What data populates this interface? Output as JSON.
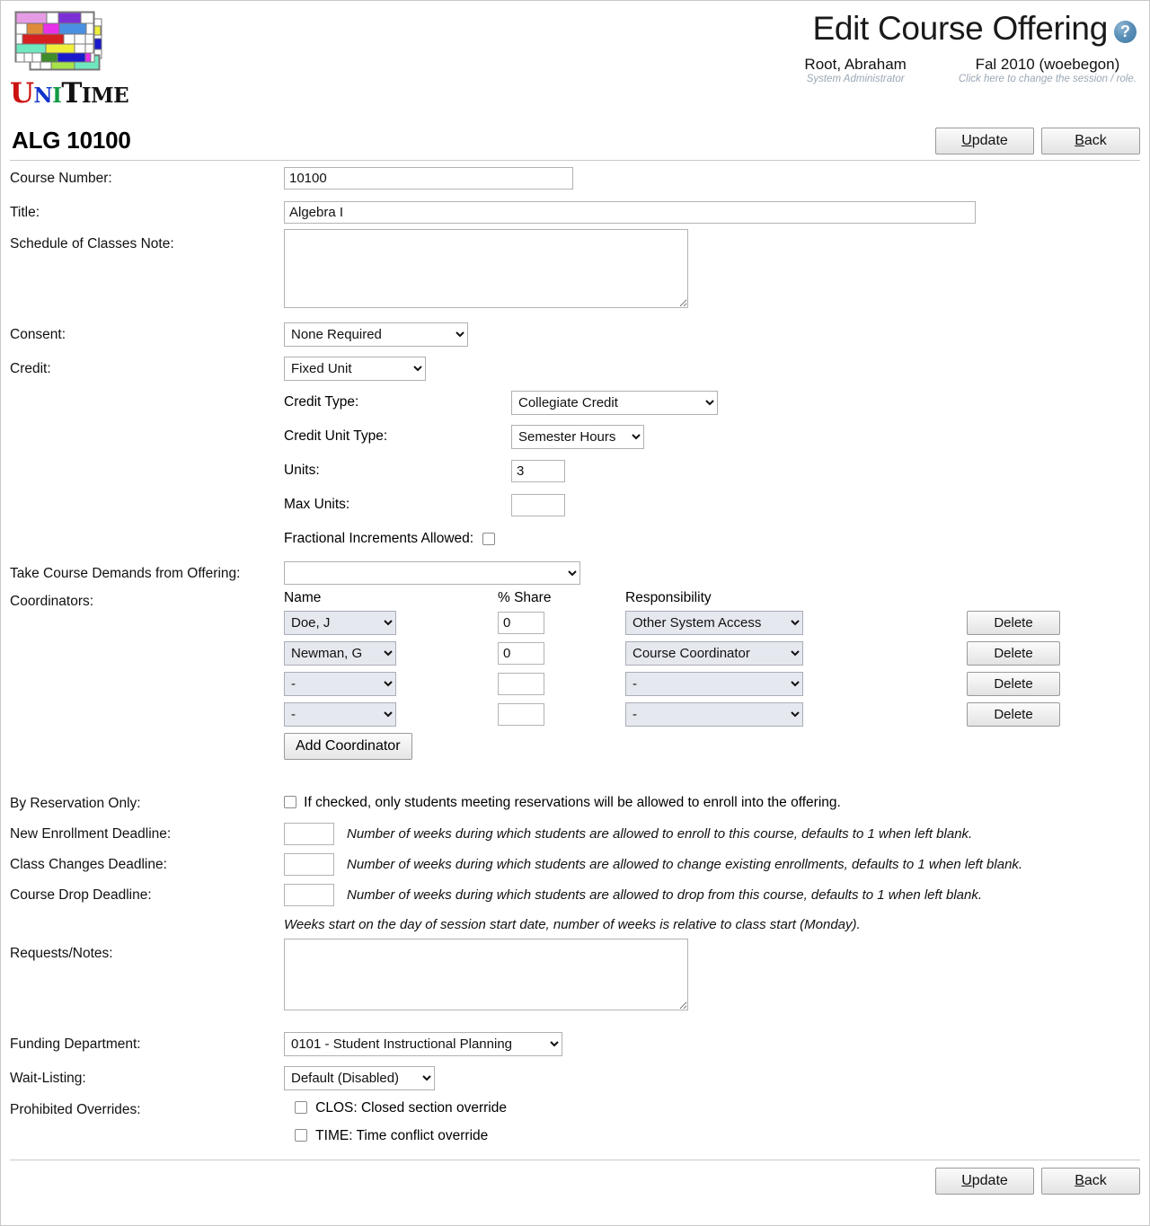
{
  "header": {
    "logo_alt": "UniTime logo",
    "wordmark": {
      "u": "U",
      "n": "N",
      "i": "I",
      "t": "T",
      "ime": "IME"
    },
    "app_title": "Edit Course Offering",
    "help_icon": "help-icon",
    "user_name": "Root, Abraham",
    "user_role": "System Administrator",
    "session": "Fal 2010 (woebegon)",
    "session_hint": "Click here to change the session / role."
  },
  "course": {
    "code": "ALG 10100"
  },
  "toolbar": {
    "update_accesskey": "U",
    "update_rest": "pdate",
    "back_accesskey": "B",
    "back_rest": "ack"
  },
  "form": {
    "course_number_label": "Course Number:",
    "course_number_value": "10100",
    "title_label": "Title:",
    "title_value": "Algebra I",
    "schedule_note_label": "Schedule of Classes Note:",
    "schedule_note_value": "",
    "consent_label": "Consent:",
    "consent_value": "None Required",
    "credit_label": "Credit:",
    "credit_value": "Fixed Unit",
    "credit_type_label": "Credit Type:",
    "credit_type_value": "Collegiate Credit",
    "credit_unit_type_label": "Credit Unit Type:",
    "credit_unit_type_value": "Semester Hours",
    "units_label": "Units:",
    "units_value": "3",
    "max_units_label": "Max Units:",
    "max_units_value": "",
    "fractional_label": "Fractional Increments Allowed:",
    "demands_label": "Take Course Demands from Offering:",
    "demands_value": "",
    "coordinators_label": "Coordinators:",
    "coord_col_name": "Name",
    "coord_col_share": "% Share",
    "coord_col_resp": "Responsibility",
    "add_coordinator_label": "Add Coordinator",
    "delete_label": "Delete",
    "reservation_label": "By Reservation Only:",
    "reservation_text": "If checked, only students meeting reservations will be allowed to enroll into the offering.",
    "new_enrollment_label": "New Enrollment Deadline:",
    "new_enrollment_value": "",
    "new_enrollment_hint": "Number of weeks during which students are allowed to enroll to this course, defaults to 1 when left blank.",
    "class_changes_label": "Class Changes Deadline:",
    "class_changes_value": "",
    "class_changes_hint": "Number of weeks during which students are allowed to change existing enrollments, defaults to 1 when left blank.",
    "course_drop_label": "Course Drop Deadline:",
    "course_drop_value": "",
    "course_drop_hint": "Number of weeks during which students are allowed to drop from this course, defaults to 1 when left blank.",
    "weeks_note": "Weeks start on the day of session start date, number of weeks is relative to class start (Monday).",
    "requests_label": "Requests/Notes:",
    "requests_value": "",
    "funding_label": "Funding Department:",
    "funding_value": "0101 - Student Instructional Planning",
    "waitlisting_label": "Wait-Listing:",
    "waitlisting_value": "Default (Disabled)",
    "overrides_label": "Prohibited Overrides:",
    "override_clos": "CLOS: Closed section override",
    "override_time": "TIME: Time conflict override"
  },
  "coordinators": [
    {
      "name": "Doe, J",
      "share": "0",
      "responsibility": "Other System Access"
    },
    {
      "name": "Newman, G",
      "share": "0",
      "responsibility": "Course Coordinator"
    },
    {
      "name": "-",
      "share": "",
      "responsibility": "-"
    },
    {
      "name": "-",
      "share": "",
      "responsibility": "-"
    }
  ],
  "colors": {
    "help_blue": "#5b90b8",
    "hint_gray": "#9aa7b4",
    "select_shaded": "#e6e8ef"
  }
}
